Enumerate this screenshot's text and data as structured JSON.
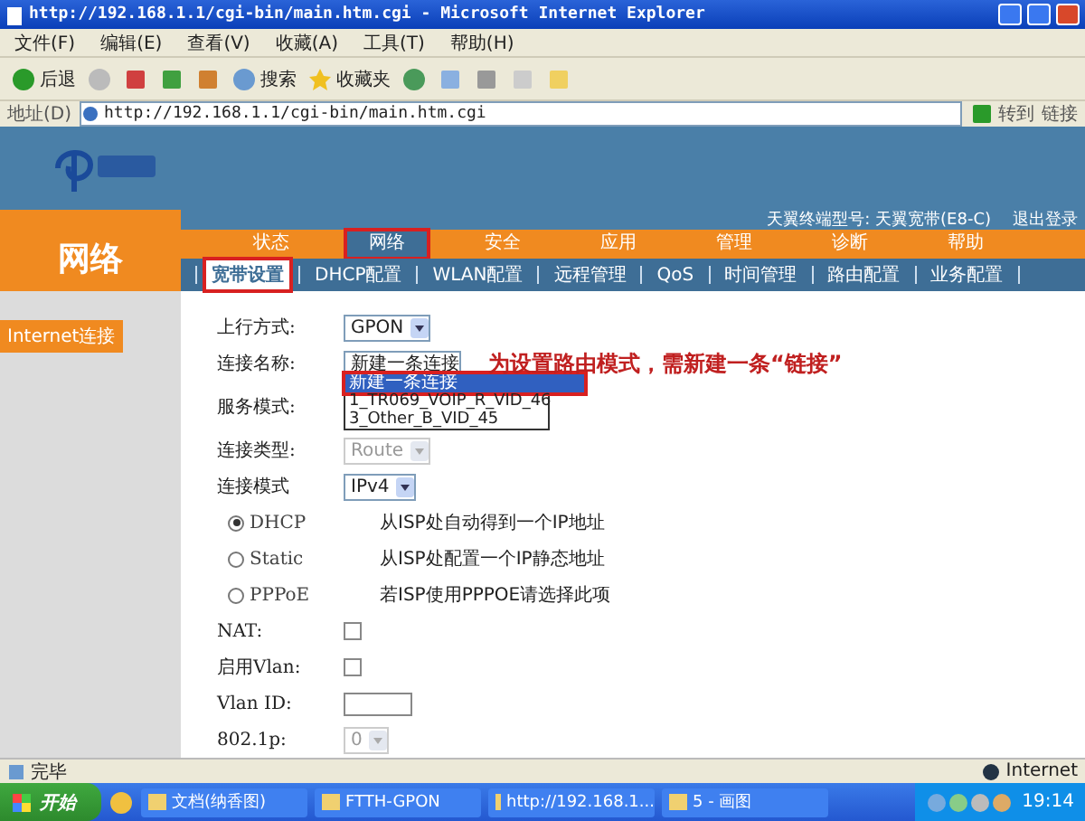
{
  "window": {
    "title": "http://192.168.1.1/cgi-bin/main.htm.cgi - Microsoft Internet Explorer"
  },
  "menu": [
    "文件(F)",
    "编辑(E)",
    "查看(V)",
    "收藏(A)",
    "工具(T)",
    "帮助(H)"
  ],
  "toolbar": {
    "back": "后退",
    "search": "搜索",
    "favorites": "收藏夹"
  },
  "address": {
    "label": "地址(D)",
    "url": "http://192.168.1.1/cgi-bin/main.htm.cgi",
    "go": "转到",
    "links": "链接"
  },
  "header": {
    "model": "天翼终端型号: 天翼宽带(E8-C)",
    "logout": "退出登录",
    "section": "网络"
  },
  "tabs": [
    {
      "label": "状态",
      "selected": false
    },
    {
      "label": "网络",
      "selected": true
    },
    {
      "label": "安全",
      "selected": false
    },
    {
      "label": "应用",
      "selected": false
    },
    {
      "label": "管理",
      "selected": false
    },
    {
      "label": "诊断",
      "selected": false
    },
    {
      "label": "帮助",
      "selected": false
    }
  ],
  "subtabs": [
    {
      "label": "宽带设置",
      "selected": true
    },
    {
      "label": "DHCP配置",
      "selected": false
    },
    {
      "label": "WLAN配置",
      "selected": false
    },
    {
      "label": "远程管理",
      "selected": false
    },
    {
      "label": "QoS",
      "selected": false
    },
    {
      "label": "时间管理",
      "selected": false
    },
    {
      "label": "路由配置",
      "selected": false
    },
    {
      "label": "业务配置",
      "selected": false
    }
  ],
  "sidebar": [
    {
      "label": "Internet连接",
      "selected": true
    }
  ],
  "annotation": "为设置路由模式，需新建一条“链接”",
  "form": [
    {
      "kind": "select",
      "label": "上行方式:",
      "value": "GPON",
      "disabled": false
    },
    {
      "kind": "dropdown",
      "label": "连接名称:",
      "value": "新建一条连接",
      "options": [
        {
          "label": "新建一条连接",
          "selected": true
        },
        {
          "label": "1_TR069_VOIP_R_VID_46",
          "selected": false
        },
        {
          "label": "3_Other_B_VID_45",
          "selected": false
        }
      ]
    },
    {
      "kind": "label",
      "label": "服务模式:"
    },
    {
      "kind": "select",
      "label": "连接类型:",
      "value": "Route",
      "disabled": true
    },
    {
      "kind": "select",
      "label": "连接模式",
      "value": "IPv4",
      "disabled": false
    },
    {
      "kind": "radio",
      "label": "DHCP",
      "selected": true,
      "text": "从ISP处自动得到一个IP地址"
    },
    {
      "kind": "radio",
      "label": "Static",
      "selected": false,
      "text": "从ISP处配置一个IP静态地址"
    },
    {
      "kind": "radio",
      "label": "PPPoE",
      "selected": false,
      "text": "若ISP使用PPPOE请选择此项"
    },
    {
      "kind": "checkbox",
      "label": "NAT:",
      "checked": false
    },
    {
      "kind": "checkbox",
      "label": "启用Vlan:",
      "checked": false
    },
    {
      "kind": "input",
      "label": "Vlan ID:"
    },
    {
      "kind": "select",
      "label": "802.1p:",
      "value": "0",
      "disabled": true
    }
  ],
  "status_bar": {
    "text": "完毕",
    "zone": "Internet"
  },
  "taskbar": {
    "start": "开始",
    "items": [
      "文档(纳香图)",
      "FTTH-GPON",
      "http://192.168.1...",
      "5 - 画图"
    ],
    "clock": "19:14"
  }
}
